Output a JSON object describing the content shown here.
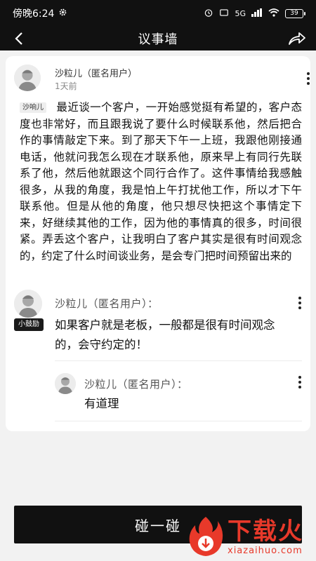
{
  "status_bar": {
    "time": "傍晚6:24",
    "network": "5G",
    "battery": "39"
  },
  "nav": {
    "title": "议事墙"
  },
  "post": {
    "author": "沙粒儿（匿名用户）",
    "time": "1天前",
    "tag": "沙响儿",
    "body": "最近谈一个客户，一开始感觉挺有希望的，客户态度也非常好，而且跟我说了要什么时候联系他，然后把合作的事情敲定下来。到了那天下午一上班，我跟他刚接通电话，他就问我怎么现在才联系他，原来早上有同行先联系了他，然后他就跟这个同行合作了。这件事情给我感触很多，从我的角度，我是怕上午打扰他工作，所以才下午联系他。但是从他的角度，他只想尽快把这个事情定下来，好继续其他的工作，因为他的事情真的很多，时间很紧。弄丢这个客户，让我明白了客户其实是很有时间观念的，约定了什么时间谈业务，是会专门把时间预留出来的"
  },
  "comments": [
    {
      "author": "沙粒儿（匿名用户）：",
      "badge": "小鼓励",
      "text": "如果客户就是老板，一般都是很有时间观念的，会守约定的！"
    },
    {
      "author": "沙粒儿（匿名用户）：",
      "text": "有道理"
    }
  ],
  "action": {
    "bump_label": "碰一碰"
  },
  "watermark": {
    "brand": "下载火",
    "domain": "xiazaihuo.com"
  },
  "colors": {
    "dark": "#111111",
    "background": "#f2f2f2",
    "watermark": "#e8392a"
  }
}
